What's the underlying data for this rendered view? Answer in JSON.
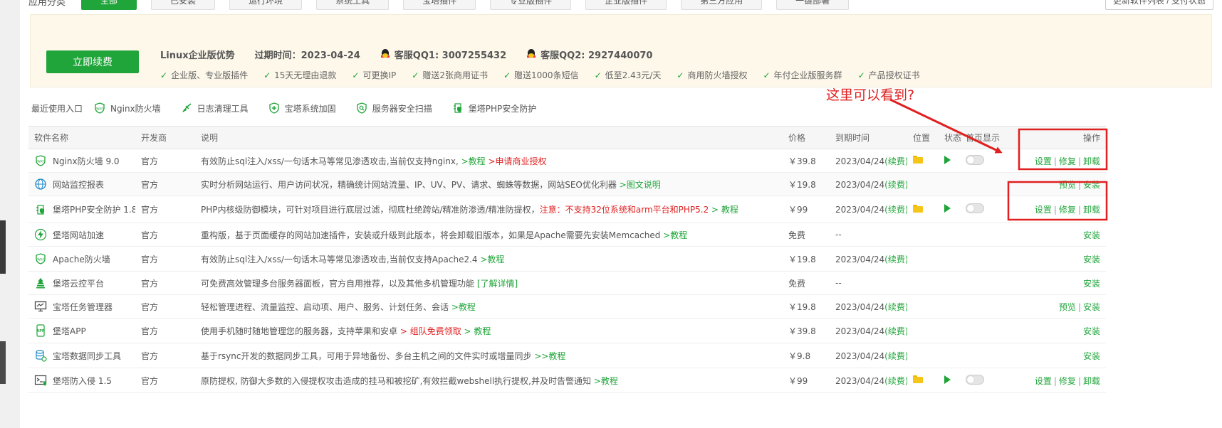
{
  "categories": {
    "label": "应用分类",
    "items": [
      "全部",
      "已安装",
      "运行环境",
      "系统工具",
      "宝塔插件",
      "专业版插件",
      "企业版插件",
      "第三方应用",
      "一键部署"
    ],
    "active_index": 0
  },
  "update_button": "更新软件列表 / 支付状态",
  "promo": {
    "renew_button": "立即续费",
    "title": "Linux企业版优势",
    "expire": "过期时间：2023-04-24",
    "qq1": "客服QQ1: 3007255432",
    "qq2": "客服QQ2: 2927440070",
    "features": [
      "企业版、专业版插件",
      "15天无理由退款",
      "可更换IP",
      "赠送2张商用证书",
      "赠送1000条短信",
      "低至2.43元/天",
      "商用防火墙授权",
      "年付企业版服务群",
      "产品授权证书"
    ]
  },
  "recent": {
    "label": "最近使用入口",
    "items": [
      {
        "label": "Nginx防火墙",
        "icon": "waf-shield-icon"
      },
      {
        "label": "日志清理工具",
        "icon": "broom-icon"
      },
      {
        "label": "宝塔系统加固",
        "icon": "shield-plus-icon"
      },
      {
        "label": "服务器安全扫描",
        "icon": "shield-search-icon"
      },
      {
        "label": "堡塔PHP安全防护",
        "icon": "php-shield-icon"
      }
    ]
  },
  "annotation": "这里可以看到?",
  "table": {
    "headers": {
      "name": "软件名称",
      "dev": "开发商",
      "desc": "说明",
      "price": "价格",
      "expire": "到期时间",
      "location": "位置",
      "status": "状态",
      "home": "首页显示",
      "ops": "操作"
    },
    "rows": [
      {
        "name": "Nginx防火墙 9.0",
        "icon": "waf-shield-icon",
        "dev": "官方",
        "desc": "有效防止sql注入/xss/一句话木马等常见渗透攻击,当前仅支持nginx,",
        "desc_green": " >教程",
        "desc_red": " >申请商业授权",
        "desc_tail": "",
        "price": "￥39.8",
        "expire": "2023/04/24",
        "renew": "(续费)",
        "folder": true,
        "play": true,
        "toggle": true,
        "ops": [
          "设置",
          "修复",
          "卸载"
        ]
      },
      {
        "name": "网站监控报表",
        "icon": "monitor-globe-icon",
        "dev": "官方",
        "desc": "实时分析网站运行、用户访问状况，精确统计网站流量、IP、UV、PV、请求、蜘蛛等数据，网站SEO优化利器",
        "desc_green": " >图文说明",
        "desc_red": "",
        "desc_tail": "",
        "price": "￥19.8",
        "expire": "2023/04/24",
        "renew": "(续费)",
        "folder": false,
        "play": false,
        "toggle": false,
        "ops": [
          "预览",
          "安装"
        ]
      },
      {
        "name": "堡塔PHP安全防护 1.8",
        "icon": "php-shield-icon",
        "dev": "官方",
        "desc": "PHP内核级防御模块，可针对项目进行底层过滤，彻底杜绝跨站/精准防渗透/精准防提权，",
        "desc_green": "",
        "desc_red": "注意：不支持32位系统和arm平台和PHP5.2",
        "desc_tail": " > 教程",
        "price": "￥99",
        "expire": "2023/04/24",
        "renew": "(续费)",
        "folder": true,
        "play": true,
        "toggle": true,
        "ops": [
          "设置",
          "修复",
          "卸载"
        ]
      },
      {
        "name": "堡塔网站加速",
        "icon": "lightning-icon",
        "dev": "官方",
        "desc": "重构版，基于页面缓存的网站加速插件，安装或升级到此版本，将会卸载旧版本，如果是Apache需要先安装Memcached",
        "desc_green": " >教程",
        "desc_red": "",
        "desc_tail": "",
        "price": "免费",
        "expire": "--",
        "renew": "",
        "folder": false,
        "play": false,
        "toggle": false,
        "ops": [
          "安装"
        ]
      },
      {
        "name": "Apache防火墙",
        "icon": "waf-shield-icon",
        "dev": "官方",
        "desc": "有效防止sql注入/xss/一句话木马等常见渗透攻击,当前仅支持Apache2.4",
        "desc_green": " >教程",
        "desc_red": "",
        "desc_tail": "",
        "price": "￥19.8",
        "expire": "2023/04/24",
        "renew": "(续费)",
        "folder": false,
        "play": false,
        "toggle": false,
        "ops": [
          "安装"
        ]
      },
      {
        "name": "堡塔云控平台",
        "icon": "cloud-tree-icon",
        "dev": "官方",
        "desc": "可免费高效管理多台服务器面板，官方自用推荐，以及其他多机管理功能",
        "desc_green": " [了解详情]",
        "desc_red": "",
        "desc_tail": "",
        "price": "免费",
        "expire": "--",
        "renew": "",
        "folder": false,
        "play": false,
        "toggle": false,
        "ops": [
          "安装"
        ]
      },
      {
        "name": "宝塔任务管理器",
        "icon": "task-monitor-icon",
        "dev": "官方",
        "desc": "轻松管理进程、流量监控、启动项、用户、服务、计划任务、会话",
        "desc_green": " >教程",
        "desc_red": "",
        "desc_tail": "",
        "price": "￥19.8",
        "expire": "2023/04/24",
        "renew": "(续费)",
        "folder": false,
        "play": false,
        "toggle": false,
        "ops": [
          "预览",
          "安装"
        ]
      },
      {
        "name": "堡塔APP",
        "icon": "app-phone-icon",
        "dev": "官方",
        "desc": "使用手机随时随地管理您的服务器，支持苹果和安卓",
        "desc_green": "",
        "desc_red": " > 组队免费领取",
        "desc_tail": " > 教程",
        "price": "￥39.8",
        "expire": "2023/04/24",
        "renew": "(续费)",
        "folder": false,
        "play": false,
        "toggle": false,
        "ops": [
          "安装"
        ]
      },
      {
        "name": "宝塔数据同步工具",
        "icon": "database-sync-icon",
        "dev": "官方",
        "desc": "基于rsync开发的数据同步工具，可用于异地备份、多台主机之间的文件实时或增量同步",
        "desc_green": " >>教程",
        "desc_red": "",
        "desc_tail": "",
        "price": "￥9.8",
        "expire": "2023/04/24",
        "renew": "(续费)",
        "folder": false,
        "play": false,
        "toggle": false,
        "ops": [
          "安装"
        ]
      },
      {
        "name": "堡塔防入侵 1.5",
        "icon": "terminal-shield-icon",
        "dev": "官方",
        "desc": "原防提权, 防御大多数的入侵提权攻击造成的挂马和被挖矿,有效拦截webshell执行提权,并及时告警通知",
        "desc_green": " >教程",
        "desc_red": "",
        "desc_tail": "",
        "price": "￥99",
        "expire": "2023/04/24",
        "renew": "(续费)",
        "folder": true,
        "play": true,
        "toggle": true,
        "ops": [
          "设置",
          "修复",
          "卸载"
        ]
      }
    ]
  },
  "colors": {
    "accent": "#20a53a",
    "price": "#ff6c00",
    "annotation": "#e02020"
  }
}
